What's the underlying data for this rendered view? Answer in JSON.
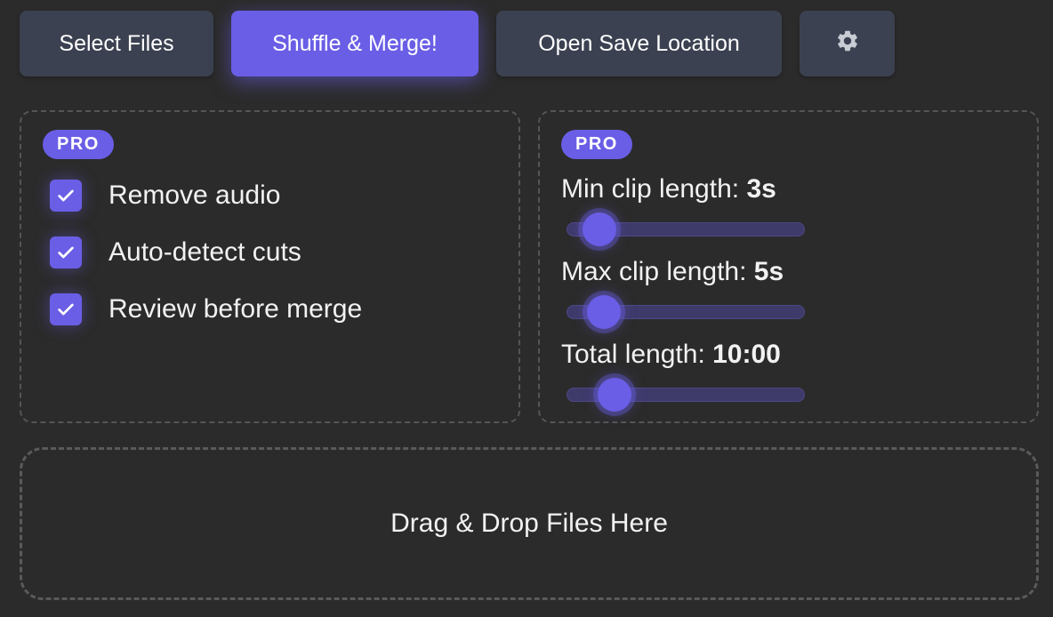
{
  "toolbar": {
    "select_label": "Select Files",
    "merge_label": "Shuffle & Merge!",
    "save_label": "Open Save Location",
    "settings_icon": "gear-icon"
  },
  "left_panel": {
    "badge": "PRO",
    "options": [
      {
        "label": "Remove audio",
        "checked": true
      },
      {
        "label": "Auto-detect cuts",
        "checked": true
      },
      {
        "label": "Review before merge",
        "checked": true
      }
    ]
  },
  "right_panel": {
    "badge": "PRO",
    "sliders": [
      {
        "label": "Min clip length: ",
        "value": "3s",
        "fraction": 0.08
      },
      {
        "label": "Max clip length: ",
        "value": "5s",
        "fraction": 0.1
      },
      {
        "label": "Total length: ",
        "value": "10:00",
        "fraction": 0.15
      }
    ]
  },
  "dropzone": {
    "label": "Drag & Drop Files Here"
  },
  "colors": {
    "accent": "#6a5ee6",
    "background": "#2b2b2b",
    "button": "#3b4150"
  }
}
